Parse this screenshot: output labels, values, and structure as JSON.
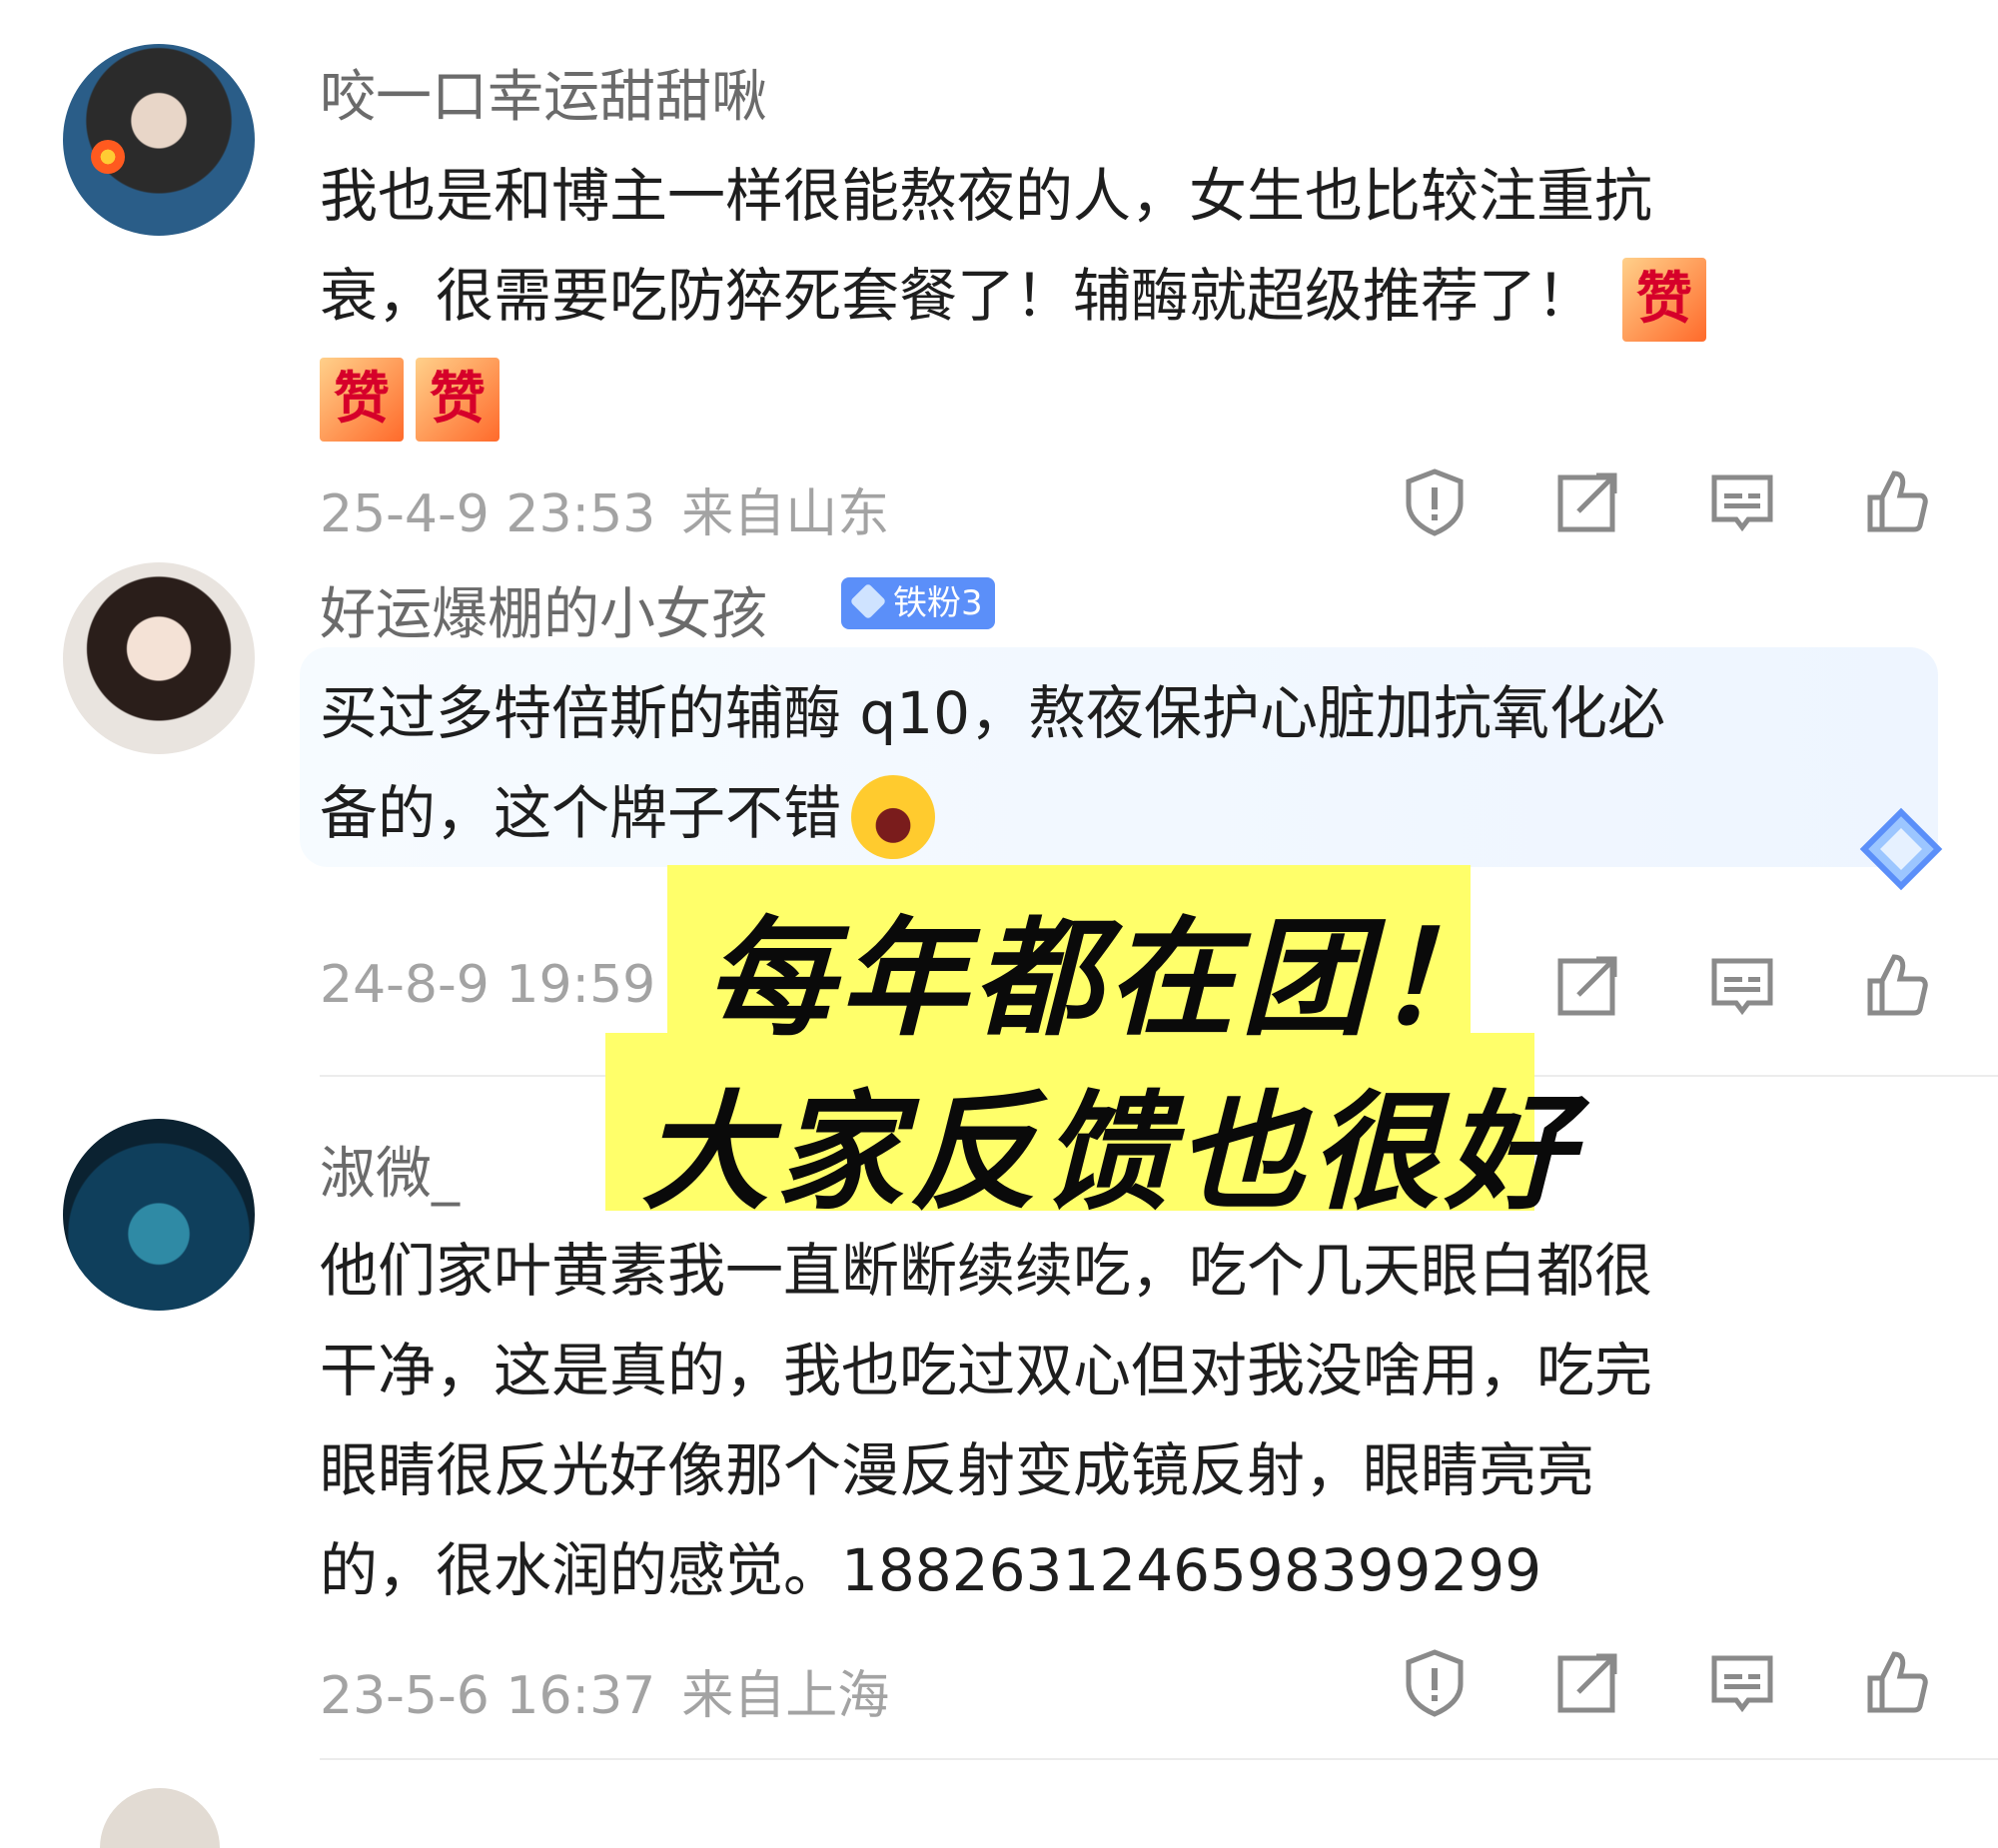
{
  "comments": [
    {
      "username": "咬一口幸运甜甜啾",
      "lines": [
        "我也是和博主一样很能熬夜的人，女生也比较注重抗",
        "衰，很需要吃防猝死套餐了！辅酶就超级推荐了！"
      ],
      "emoji_label": "赞",
      "time": "25-4-9 23:53",
      "location": "来自山东"
    },
    {
      "username": "好运爆棚的小女孩",
      "badge": "铁粉3",
      "lines": [
        "买过多特倍斯的辅酶 q10，熬夜保护心脏加抗氧化必",
        "备的，这个牌子不错"
      ],
      "time": "24-8-9 19:59"
    },
    {
      "username": "淑微_",
      "lines": [
        "他们家叶黄素我一直断断续续吃，吃个几天眼白都很",
        "干净，这是真的，我也吃过双心但对我没啥用，吃完",
        "眼睛很反光好像那个漫反射变成镜反射，眼睛亮亮",
        "的，很水润的感觉。18826312465983992­99"
      ],
      "time": "23-5-6 16:37",
      "location": "来自上海"
    }
  ],
  "overlay": {
    "line1": "每年都在团！",
    "line2": "大家反馈也很好",
    "background": "#ffff6a"
  },
  "icons": [
    "report-icon",
    "repost-icon",
    "comment-icon",
    "like-icon"
  ]
}
